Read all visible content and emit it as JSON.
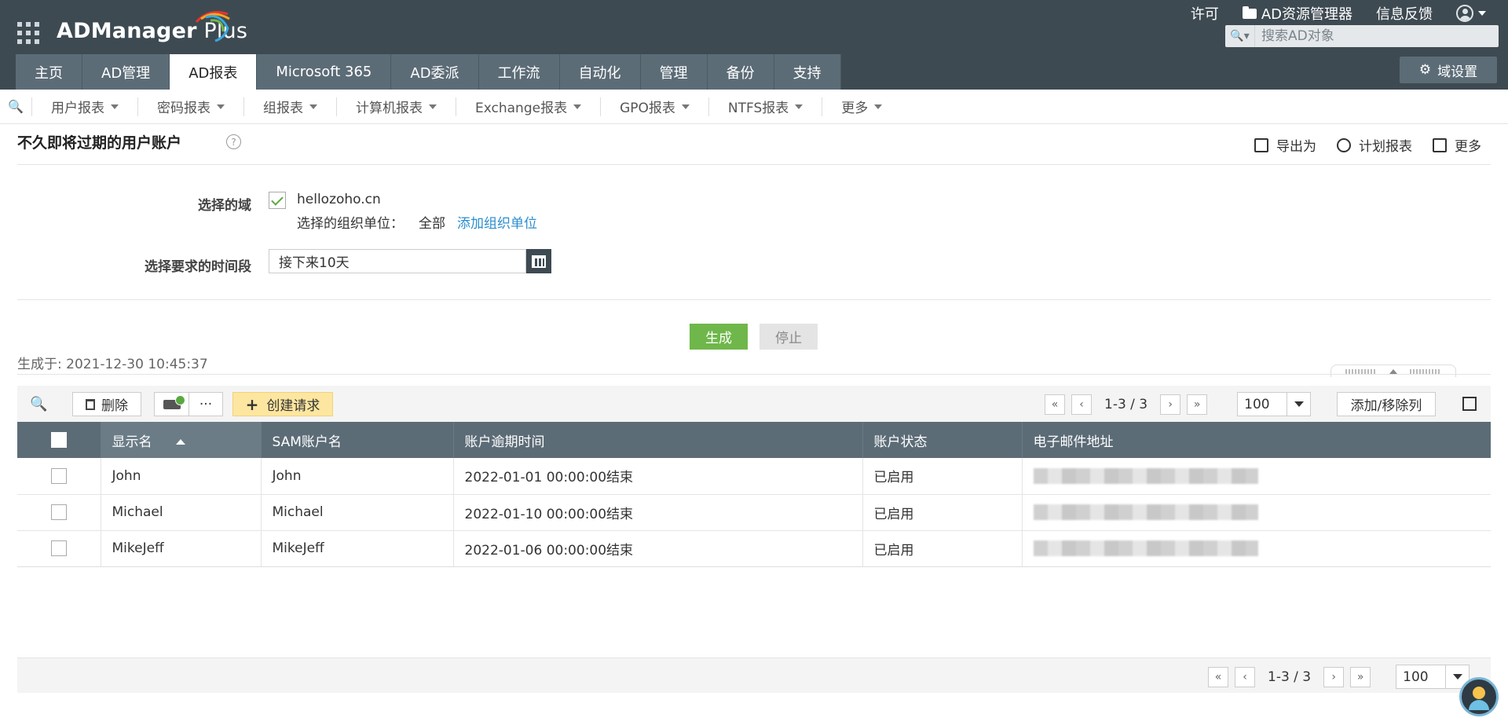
{
  "app": {
    "logo_text": "ADManager",
    "logo_plus": " Plus"
  },
  "header": {
    "license": "许可",
    "ad_explorer": "AD资源管理器",
    "feedback": "信息反馈",
    "search_placeholder": "搜索AD对象"
  },
  "main_tabs": [
    {
      "label": "主页",
      "active": false
    },
    {
      "label": "AD管理",
      "active": false
    },
    {
      "label": "AD报表",
      "active": true
    },
    {
      "label": "Microsoft 365",
      "active": false
    },
    {
      "label": "AD委派",
      "active": false
    },
    {
      "label": "工作流",
      "active": false
    },
    {
      "label": "自动化",
      "active": false
    },
    {
      "label": "管理",
      "active": false
    },
    {
      "label": "备份",
      "active": false
    },
    {
      "label": "支持",
      "active": false
    }
  ],
  "domain_settings": "域设置",
  "sub_tabs": [
    "用户报表",
    "密码报表",
    "组报表",
    "计算机报表",
    "Exchange报表",
    "GPO报表",
    "NTFS报表",
    "更多"
  ],
  "page": {
    "title": "不久即将过期的用户账户",
    "help": "?",
    "actions": {
      "export": "导出为",
      "schedule": "计划报表",
      "more": "更多"
    }
  },
  "form": {
    "domain_label": "选择的域",
    "domain_value": "hellozoho.cn",
    "ou_label": "选择的组织单位：",
    "ou_value": "全部",
    "add_ou": "添加组织单位",
    "period_label": "选择要求的时间段",
    "period_value": "接下来10天",
    "generate": "生成",
    "stop": "停止"
  },
  "generated_at": "生成于: 2021-12-30 10:45:37",
  "toolbar": {
    "delete": "删除",
    "more_dots": "···",
    "create_request": "创建请求",
    "page_range": "1-3 / 3",
    "per_page": "100",
    "add_remove_columns": "添加/移除列"
  },
  "table": {
    "columns": [
      "显示名",
      "SAM账户名",
      "账户逾期时间",
      "账户状态",
      "电子邮件地址"
    ],
    "rows": [
      {
        "display_name": "John",
        "sam": "John",
        "expiry": "2022-01-01 00:00:00结束",
        "status": "已启用"
      },
      {
        "display_name": "Michael",
        "sam": "Michael",
        "expiry": "2022-01-10 00:00:00结束",
        "status": "已启用"
      },
      {
        "display_name": "MikeJeff",
        "sam": "MikeJeff",
        "expiry": "2022-01-06 00:00:00结束",
        "status": "已启用"
      }
    ]
  },
  "footer": {
    "page_range": "1-3 / 3",
    "per_page": "100"
  },
  "colors": {
    "header_bg": "#3e4a52",
    "tab_bg": "#5c6c77",
    "generate_green": "#6fb74a",
    "link_blue": "#2b8ecf",
    "create_yellow": "#fde6a0"
  }
}
